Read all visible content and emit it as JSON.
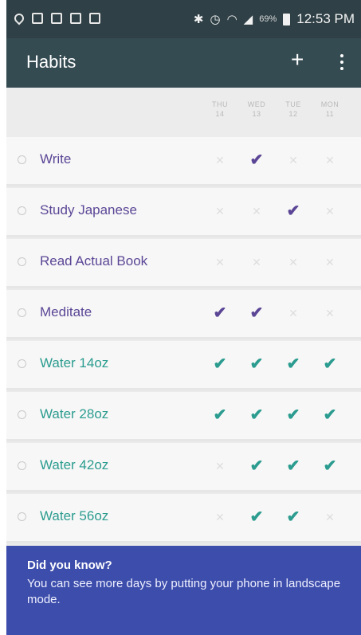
{
  "status_bar": {
    "time": "12:53 PM",
    "battery_percent": "69%",
    "left_icons": [
      "location-icon",
      "image-icon",
      "card-icon",
      "gallery-icon",
      "app-icon"
    ],
    "right_icons": [
      "bluetooth-icon",
      "alarm-icon",
      "wifi-icon",
      "signal-icon",
      "battery-icon"
    ]
  },
  "toolbar": {
    "title": "Habits",
    "add_label": "+",
    "menu_icon": "more-vert-icon"
  },
  "days": [
    {
      "name": "THU",
      "date": "14"
    },
    {
      "name": "WED",
      "date": "13"
    },
    {
      "name": "TUE",
      "date": "12"
    },
    {
      "name": "MON",
      "date": "11"
    }
  ],
  "symbols": {
    "done": "✔",
    "missed": "✕"
  },
  "colors": {
    "status_bar": "#2f4046",
    "toolbar": "#354b52",
    "purple": "#5b4696",
    "teal": "#2b9c8f",
    "tip_background": "#3d4dab"
  },
  "habits": [
    {
      "name": "Write",
      "color": "purple",
      "checks": [
        false,
        true,
        false,
        false
      ]
    },
    {
      "name": "Study Japanese",
      "color": "purple",
      "checks": [
        false,
        false,
        true,
        false
      ]
    },
    {
      "name": "Read Actual Book",
      "color": "purple",
      "checks": [
        false,
        false,
        false,
        false
      ]
    },
    {
      "name": "Meditate",
      "color": "purple",
      "checks": [
        true,
        true,
        false,
        false
      ]
    },
    {
      "name": "Water 14oz",
      "color": "teal",
      "checks": [
        true,
        true,
        true,
        true
      ]
    },
    {
      "name": "Water 28oz",
      "color": "teal",
      "checks": [
        true,
        true,
        true,
        true
      ]
    },
    {
      "name": "Water 42oz",
      "color": "teal",
      "checks": [
        false,
        true,
        true,
        true
      ]
    },
    {
      "name": "Water 56oz",
      "color": "teal",
      "checks": [
        false,
        true,
        true,
        false
      ]
    }
  ],
  "tip": {
    "title": "Did you know?",
    "body": "You can see more days by putting your phone in landscape mode."
  }
}
